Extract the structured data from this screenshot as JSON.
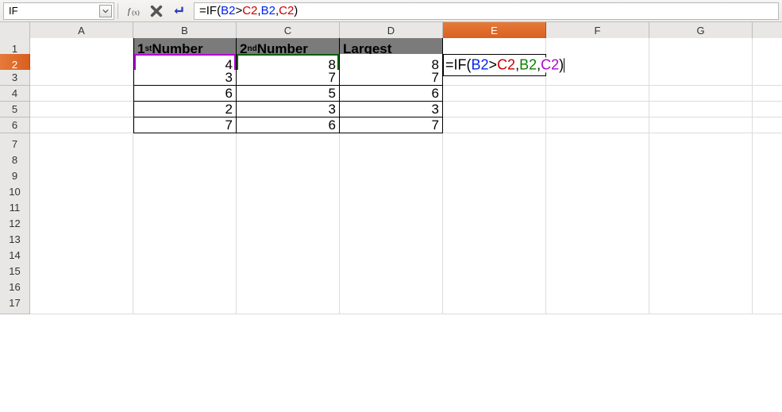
{
  "namebox": {
    "value": "IF"
  },
  "formula_bar": {
    "text": "=IF(B2>C2,B2,C2)",
    "tokens": [
      {
        "t": "=IF(",
        "cls": ""
      },
      {
        "t": "B2",
        "cls": "tok-b2"
      },
      {
        "t": ">",
        "cls": ""
      },
      {
        "t": "C2",
        "cls": "tok-c2"
      },
      {
        "t": ",",
        "cls": ""
      },
      {
        "t": "B2",
        "cls": "tok-b2"
      },
      {
        "t": ",",
        "cls": ""
      },
      {
        "t": "C2",
        "cls": "tok-c2"
      },
      {
        "t": ")",
        "cls": ""
      }
    ]
  },
  "columns": [
    "A",
    "B",
    "C",
    "D",
    "E",
    "F",
    "G",
    ""
  ],
  "active_col_index": 4,
  "active_row_index": 1,
  "table": {
    "headers": {
      "b": {
        "pre": "1",
        "sup": "st",
        "post": " Number"
      },
      "c": {
        "pre": "2",
        "sup": "nd",
        "post": " Number"
      },
      "d": {
        "pre": "Largest",
        "sup": "",
        "post": ""
      }
    },
    "rows": [
      {
        "b": "4",
        "c": "8",
        "d": "8"
      },
      {
        "b": "3",
        "c": "7",
        "d": "7"
      },
      {
        "b": "6",
        "c": "5",
        "d": "6"
      },
      {
        "b": "2",
        "c": "3",
        "d": "3"
      },
      {
        "b": "7",
        "c": "6",
        "d": "7"
      }
    ]
  },
  "edit_cell": {
    "address": "E2",
    "tokens": [
      {
        "t": "=IF(",
        "cls": ""
      },
      {
        "t": "B2",
        "cls": "tok-b2"
      },
      {
        "t": ">",
        "cls": ""
      },
      {
        "t": "C2",
        "cls": "tok-c2"
      },
      {
        "t": ",",
        "cls": ""
      },
      {
        "t": "B2",
        "cls": "tok-b2b"
      },
      {
        "t": ",",
        "cls": ""
      },
      {
        "t": "C2",
        "cls": "tok-c2b"
      },
      {
        "t": ")",
        "cls": ""
      }
    ]
  },
  "row_labels": [
    "1",
    "2",
    "3",
    "4",
    "5",
    "6",
    "7",
    "8",
    "9",
    "10",
    "11",
    "12",
    "13",
    "14",
    "15",
    "16",
    "17"
  ],
  "chart_data": {
    "type": "table",
    "columns": [
      "1st Number",
      "2nd Number",
      "Largest"
    ],
    "rows": [
      [
        4,
        8,
        8
      ],
      [
        3,
        7,
        7
      ],
      [
        6,
        5,
        6
      ],
      [
        2,
        3,
        3
      ],
      [
        7,
        6,
        7
      ]
    ]
  }
}
